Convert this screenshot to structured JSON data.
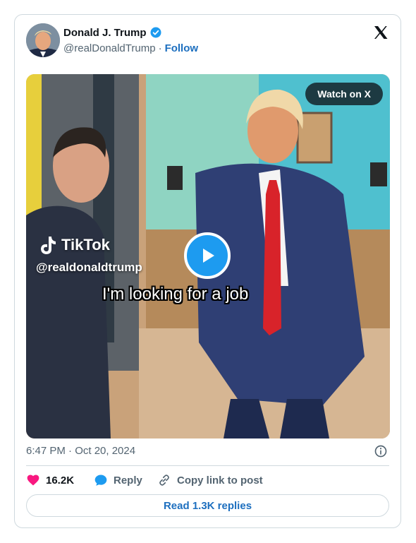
{
  "author": {
    "name": "Donald J. Trump",
    "handle": "@realDonaldTrump",
    "separator": "·",
    "follow_label": "Follow"
  },
  "media": {
    "watch_label": "Watch on X",
    "tiktok_brand": "TikTok",
    "tiktok_handle": "@realdonaldtrump",
    "caption": "I'm looking for a job"
  },
  "post": {
    "timestamp": "6:47 PM · Oct 20, 2024"
  },
  "actions": {
    "likes": "16.2K",
    "reply_label": "Reply",
    "copy_label": "Copy link to post"
  },
  "footer": {
    "read_replies": "Read 1.3K replies"
  },
  "colors": {
    "accent": "#1d9bf0",
    "link": "#1d6fbf",
    "like": "#f91880",
    "text": "#0f1419",
    "muted": "#536471",
    "border": "#cfd9de"
  }
}
